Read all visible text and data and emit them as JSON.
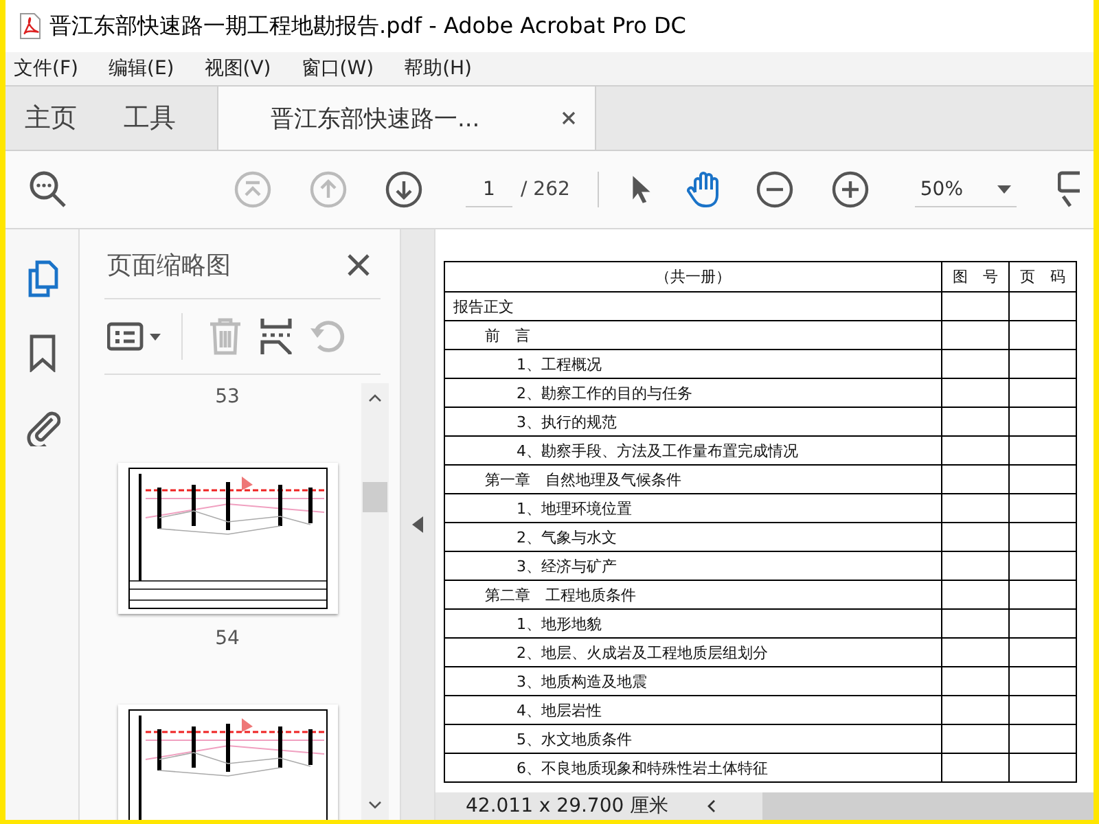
{
  "window": {
    "title": "晋江东部快速路一期工程地勘报告.pdf - Adobe Acrobat Pro DC"
  },
  "menu": [
    "文件(F)",
    "编辑(E)",
    "视图(V)",
    "窗口(W)",
    "帮助(H)"
  ],
  "tabs": [
    {
      "label": "主页",
      "kind": "nav",
      "selected": false
    },
    {
      "label": "工具",
      "kind": "nav",
      "selected": false
    },
    {
      "label": "晋江东部快速路一...",
      "kind": "document",
      "selected": true
    }
  ],
  "toolbar": {
    "nav": [
      {
        "kind": "first",
        "disabled": true
      },
      {
        "kind": "prev",
        "disabled": true
      },
      {
        "kind": "next",
        "disabled": false
      }
    ],
    "page": "1",
    "page_total": "/ 262",
    "tools": [
      {
        "kind": "select",
        "selected": false
      },
      {
        "kind": "hand",
        "selected": true
      }
    ],
    "zoom": "50%"
  },
  "sidebar": {
    "tools": [
      {
        "kind": "pages",
        "selected": true
      },
      {
        "kind": "bookmarks",
        "selected": false
      },
      {
        "kind": "attachments",
        "selected": false
      }
    ]
  },
  "thumbnails_panel": {
    "title": "页面缩略图",
    "actions": [
      {
        "kind": "options",
        "disabled": false
      },
      {
        "kind": "delete",
        "disabled": true
      },
      {
        "kind": "insert",
        "disabled": false
      },
      {
        "kind": "rotate",
        "disabled": true
      }
    ],
    "items": [
      {
        "kind": "label",
        "text": "53"
      },
      {
        "kind": "thumbnail"
      },
      {
        "kind": "label",
        "text": "54"
      },
      {
        "kind": "thumbnail"
      }
    ]
  },
  "document": {
    "header": [
      "（共一册）",
      "图　号",
      "页　码"
    ],
    "toc": [
      {
        "text": "报告正文",
        "children": [
          {
            "text": "前　言",
            "children": [
              {
                "text": "1、工程概况"
              },
              {
                "text": "2、勘察工作的目的与任务"
              },
              {
                "text": "3、执行的规范"
              },
              {
                "text": "4、勘察手段、方法及工作量布置完成情况"
              }
            ]
          },
          {
            "text": "第一章　自然地理及气候条件",
            "children": [
              {
                "text": "1、地理环境位置"
              },
              {
                "text": "2、气象与水文"
              },
              {
                "text": "3、经济与矿产"
              }
            ]
          },
          {
            "text": "第二章　工程地质条件",
            "children": [
              {
                "text": "1、地形地貌"
              },
              {
                "text": "2、地层、火成岩及工程地质层组划分"
              },
              {
                "text": "3、地质构造及地震"
              },
              {
                "text": "4、地层岩性"
              },
              {
                "text": "5、水文地质条件"
              },
              {
                "text": "6、不良地质现象和特殊性岩土体特征"
              }
            ]
          }
        ]
      }
    ]
  },
  "status_bar": {
    "page_size": "42.011 x 29.700 厘米"
  }
}
